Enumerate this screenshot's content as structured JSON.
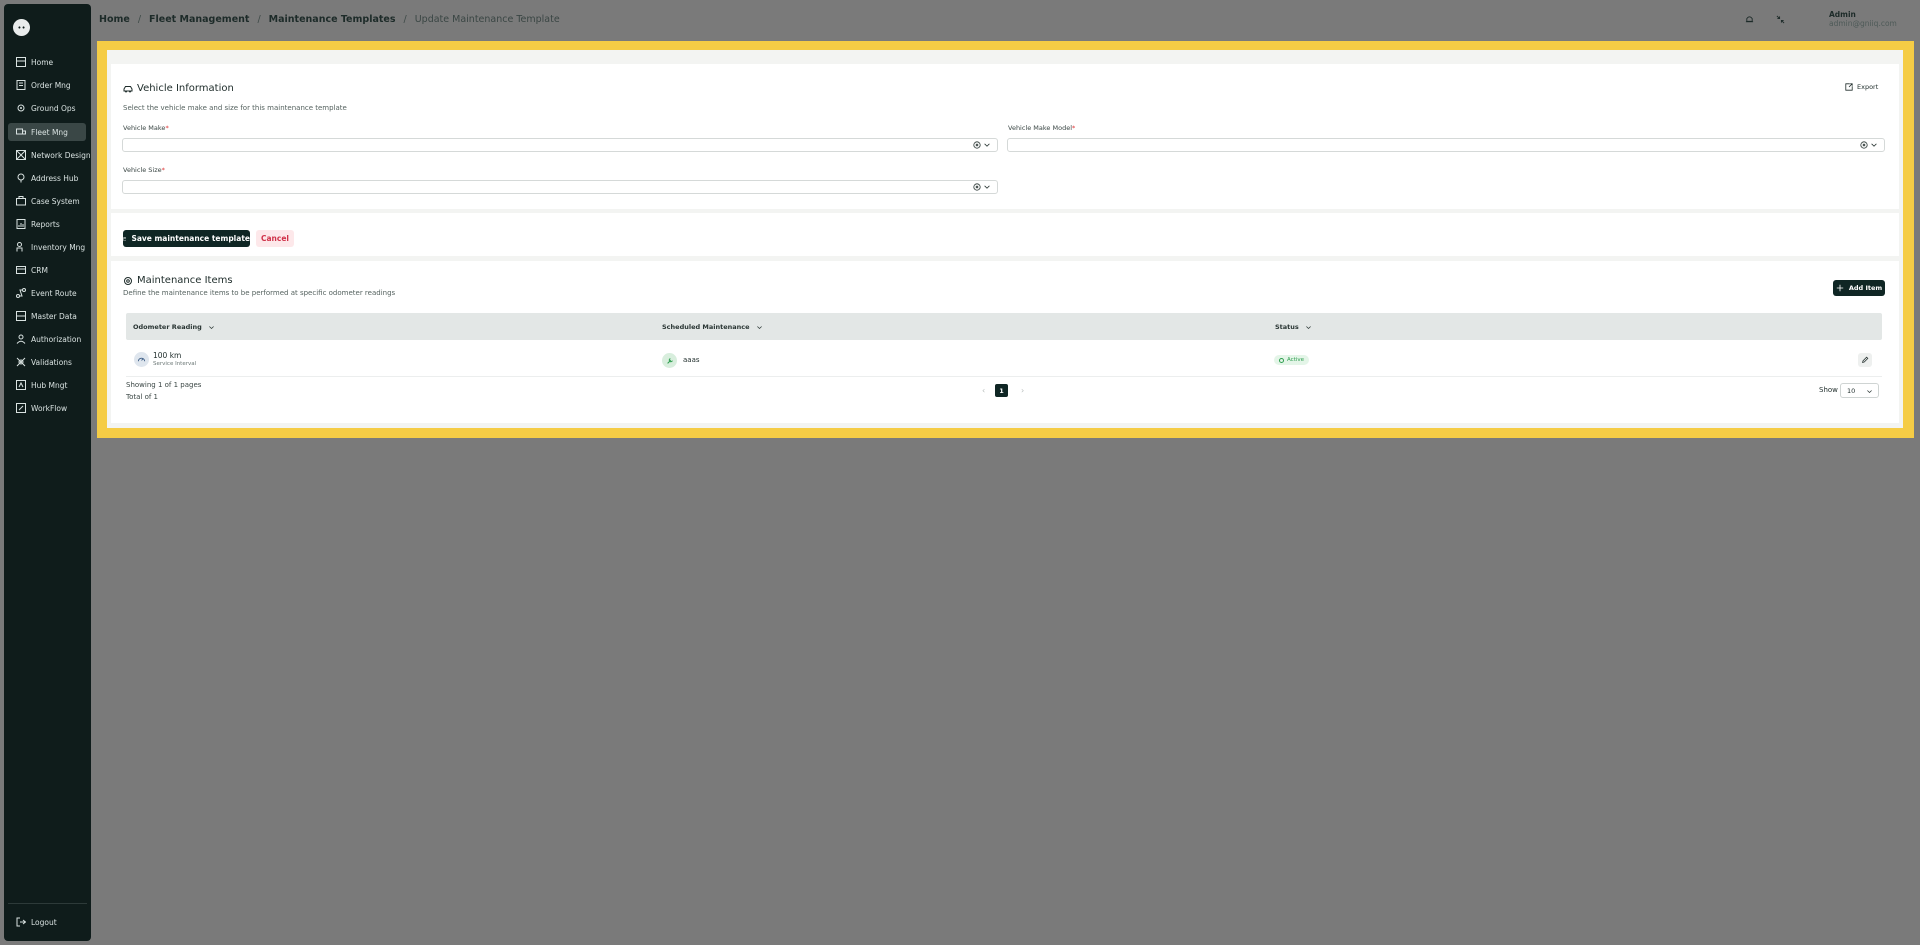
{
  "sidebar": {
    "logo_text": "••",
    "items": [
      {
        "label": "Home",
        "icon": "grid-icon"
      },
      {
        "label": "Order Mng",
        "icon": "order-icon"
      },
      {
        "label": "Ground Ops",
        "icon": "gear-icon"
      },
      {
        "label": "Fleet Mng",
        "icon": "truck-icon"
      },
      {
        "label": "Network Design",
        "icon": "network-icon"
      },
      {
        "label": "Address Hub",
        "icon": "location-icon"
      },
      {
        "label": "Case System",
        "icon": "case-icon"
      },
      {
        "label": "Reports",
        "icon": "report-icon"
      },
      {
        "label": "Inventory Mng",
        "icon": "inventory-icon"
      },
      {
        "label": "CRM",
        "icon": "crm-icon"
      },
      {
        "label": "Event Route",
        "icon": "route-icon"
      },
      {
        "label": "Master Data",
        "icon": "database-icon"
      },
      {
        "label": "Authorization",
        "icon": "user-icon"
      },
      {
        "label": "Validations",
        "icon": "validation-icon"
      },
      {
        "label": "Hub Mngt",
        "icon": "hub-icon"
      },
      {
        "label": "WorkFlow",
        "icon": "workflow-icon"
      }
    ],
    "active_index": 3,
    "logout_label": "Logout"
  },
  "header": {
    "breadcrumb": [
      "Home",
      "Fleet Management",
      "Maintenance Templates",
      "Update Maintenance Template"
    ],
    "user_name": "Admin",
    "user_email": "admin@gniiq.com"
  },
  "vehicle_info": {
    "title": "Vehicle Information",
    "description": "Select the vehicle make and size for this maintenance template",
    "export_label": "Export",
    "make_label": "Vehicle Make",
    "model_label": "Vehicle Make Model",
    "size_label": "Vehicle Size",
    "required_mark": "*"
  },
  "actions": {
    "save_label": "Save maintenance template",
    "cancel_label": "Cancel"
  },
  "maintenance": {
    "title": "Maintenance Items",
    "description": "Define the maintenance items to be performed at specific odometer readings",
    "add_label": "Add Item",
    "columns": [
      "Odometer Reading",
      "Scheduled Maintenance",
      "Status"
    ],
    "rows": [
      {
        "odometer": "100 km",
        "odometer_sub": "Service Interval",
        "maintenance": "aaas",
        "status": "Active"
      }
    ],
    "showing_text": "Showing 1 of 1 pages",
    "total_text": "Total of 1",
    "current_page": "1",
    "show_label": "Show",
    "page_size": "10"
  },
  "colors": {
    "accent": "#0f2624",
    "frame_highlight": "#f5cc45",
    "status_active": "#2e9e4f",
    "cancel": "#d0334a"
  }
}
